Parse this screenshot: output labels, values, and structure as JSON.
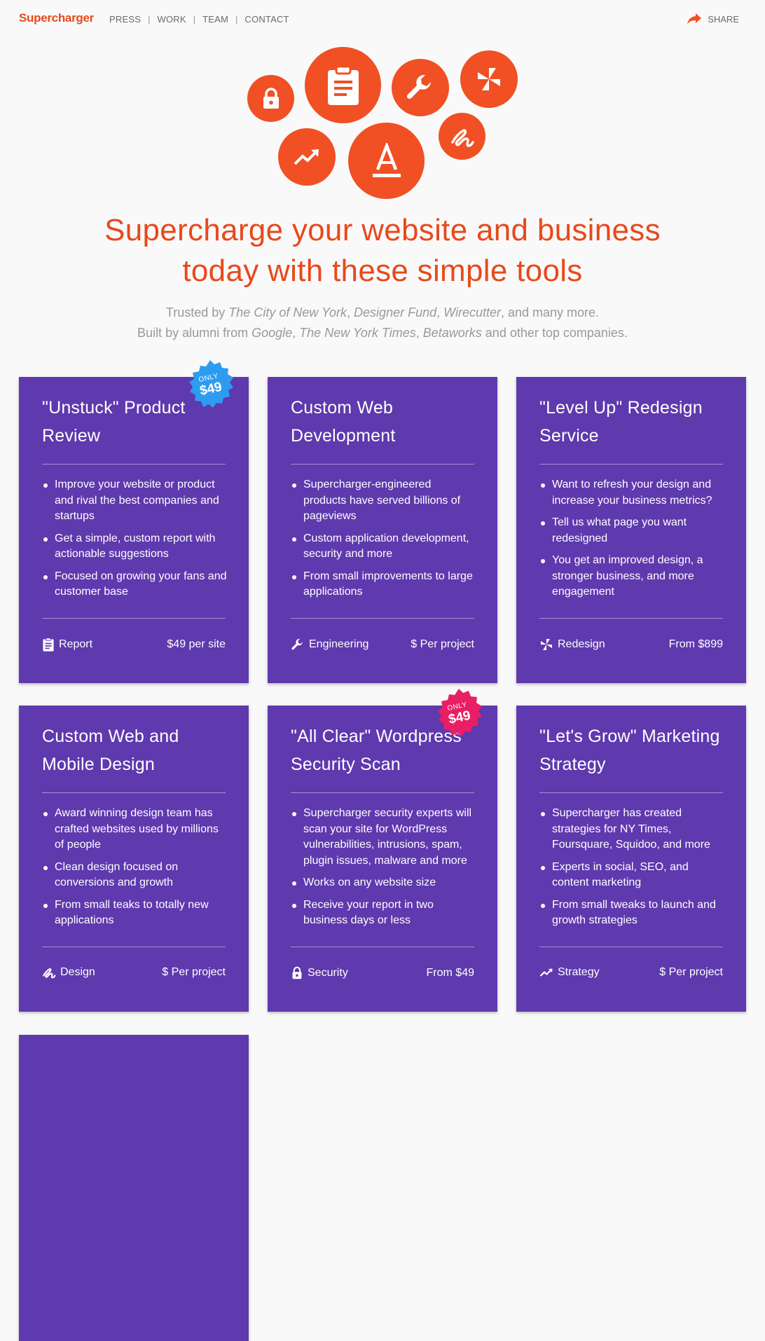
{
  "header": {
    "logo": "Supercharger",
    "nav": [
      "PRESS",
      "WORK",
      "TEAM",
      "CONTACT"
    ],
    "share_label": "SHARE"
  },
  "hero": {
    "icons": [
      "lock-icon",
      "clipboard-icon",
      "wrench-icon",
      "pinwheel-icon",
      "trending-up-icon",
      "text-format-icon",
      "gesture-icon"
    ],
    "headline_line1": "Supercharge your website and business",
    "headline_line2": "today with these simple tools",
    "trusted_prefix": "Trusted by ",
    "trusted_1": "The City of New York",
    "trusted_sep1": ", ",
    "trusted_2": "Designer Fund",
    "trusted_sep2": ", ",
    "trusted_3": "Wirecutter",
    "trusted_suffix": ", and many more.",
    "built_prefix": "Built by alumni from ",
    "built_1": "Google",
    "built_sep1": ", ",
    "built_2": "The New York Times",
    "built_sep2": ", ",
    "built_3": "Betaworks",
    "built_suffix": " and other top companies."
  },
  "colors": {
    "accent": "#e8491c",
    "card": "#5f39ae",
    "badge_blue": "#2d9bf0",
    "badge_pink": "#e91e63"
  },
  "cards": [
    {
      "title": "\"Unstuck\" Product Review",
      "bullets": [
        "Improve your website or product and rival the best companies and startups",
        "Get a simple, custom report with actionable suggestions",
        "Focused on growing your fans and customer base"
      ],
      "tag": "Report",
      "tag_icon": "clipboard-icon",
      "price": "$49 per site",
      "badge": {
        "top": "ONLY",
        "price": "$49",
        "color": "blue"
      }
    },
    {
      "title": "Custom Web Development",
      "bullets": [
        "Supercharger-engineered products have served billions of pageviews",
        "Custom application development, security and more",
        "From small improvements to large applications"
      ],
      "tag": "Engineering",
      "tag_icon": "wrench-icon",
      "price": "$ Per project"
    },
    {
      "title": "\"Level Up\" Redesign Service",
      "bullets": [
        "Want to refresh your design and increase your business metrics?",
        "Tell us what page you want redesigned",
        "You get an improved design, a stronger business, and more engagement"
      ],
      "tag": "Redesign",
      "tag_icon": "pinwheel-icon",
      "price": "From $899"
    },
    {
      "title": "Custom Web and Mobile Design",
      "bullets": [
        "Award winning design team has crafted websites used by millions of people",
        "Clean design focused on conversions and growth",
        "From small teaks to totally new applications"
      ],
      "tag": "Design",
      "tag_icon": "gesture-icon",
      "price": "$ Per project"
    },
    {
      "title": "\"All Clear\" Wordpress Security Scan",
      "bullets": [
        "Supercharger security experts will scan your site for WordPress vulnerabilities, intrusions, spam, plugin issues, malware and more",
        "Works on any website size",
        "Receive your report in two business days or less"
      ],
      "tag": "Security",
      "tag_icon": "lock-icon",
      "price": "From $49",
      "badge": {
        "top": "ONLY",
        "price": "$49",
        "color": "pink"
      }
    },
    {
      "title": "\"Let's Grow\" Marketing Strategy",
      "bullets": [
        "Supercharger has created strategies for NY Times, Foursquare, Squidoo, and more",
        "Experts in social, SEO, and content marketing",
        "From small tweaks to launch and growth strategies"
      ],
      "tag": "Strategy",
      "tag_icon": "trending-up-icon",
      "price": "$ Per project"
    }
  ]
}
